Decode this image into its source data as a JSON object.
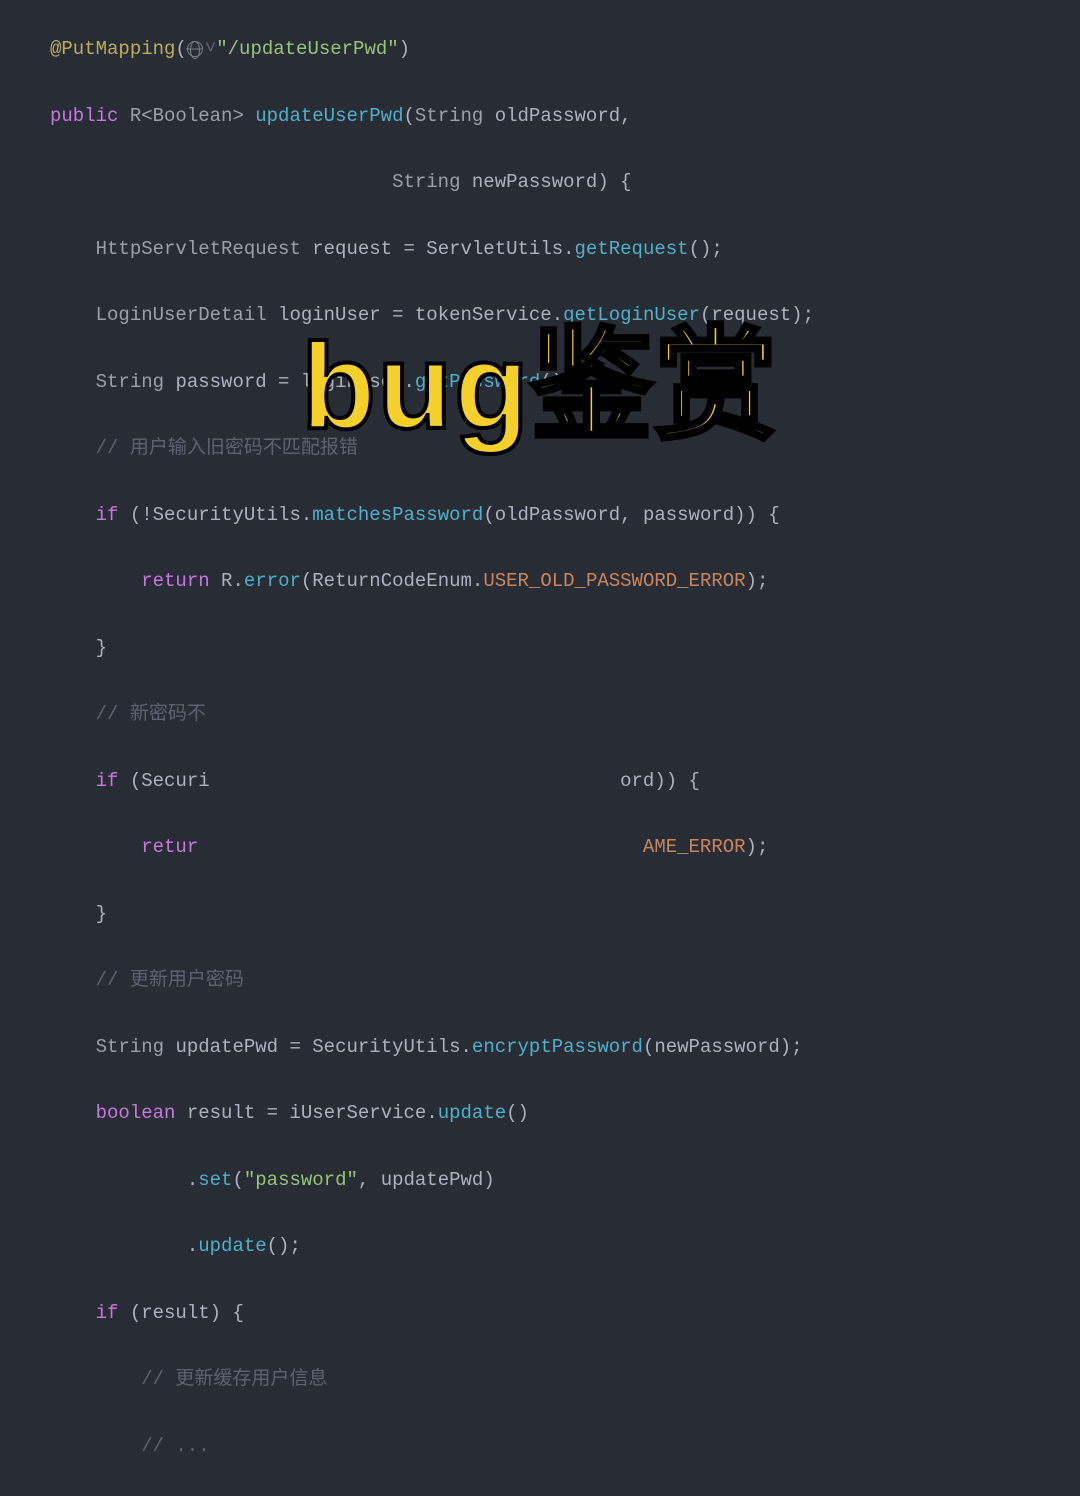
{
  "overlay": {
    "title": "bug鉴赏"
  },
  "code": {
    "l1": {
      "annotation": "@PutMapping",
      "paren_open": "(",
      "icon_suffix": "˅",
      "string": "\"/updateUserPwd\"",
      "paren_close": ")"
    },
    "l2": {
      "kw_public": "public",
      "type1": " R<Boolean> ",
      "method": "updateUserPwd",
      "paren_open": "(",
      "type2": "String ",
      "param1": "oldPassword",
      "comma": ","
    },
    "l3": {
      "indent": "                              ",
      "type": "String ",
      "param": "newPassword",
      "paren_close": ")",
      "brace": " {"
    },
    "l4": {
      "indent": "    ",
      "type1": "HttpServletRequest ",
      "var": "request",
      "eq": " = ",
      "cls": "ServletUtils",
      "dot": ".",
      "method": "getRequest",
      "call": "();"
    },
    "l5": {
      "indent": "    ",
      "type1": "LoginUserDetail ",
      "var": "loginUser",
      "eq": " = ",
      "obj": "tokenService",
      "dot": ".",
      "method": "getLoginUser",
      "args": "(request);"
    },
    "l6": {
      "indent": "    ",
      "type1": "String ",
      "var": "password",
      "eq": " = ",
      "obj": "loginUser",
      "dot": ".",
      "method": "getPassword",
      "call": "();"
    },
    "l7": {
      "indent": "    ",
      "comment": "// 用户输入旧密码不匹配报错"
    },
    "l8": {
      "indent": "    ",
      "kw_if": "if",
      "paren": " (!",
      "cls": "SecurityUtils",
      "dot": ".",
      "method": "matchesPassword",
      "args": "(oldPassword, password)) {"
    },
    "l9": {
      "indent": "        ",
      "kw_return": "return",
      "sp": " ",
      "cls": "R",
      "dot": ".",
      "method": "error",
      "paren_open": "(",
      "enum": "ReturnCodeEnum",
      "dot2": ".",
      "constant": "USER_OLD_PASSWORD_ERROR",
      "paren_close": ");"
    },
    "l10": {
      "indent": "    ",
      "brace": "}"
    },
    "l11": {
      "indent": "    ",
      "comment": "// 新密码不"
    },
    "l12": {
      "indent": "    ",
      "kw_if": "if",
      "paren": " (",
      "cls": "Securi",
      "tail": "ord)) {"
    },
    "l13": {
      "indent": "        ",
      "kw_return": "retur",
      "constant": "AME_ERROR",
      "paren_close": ");"
    },
    "l14": {
      "indent": "    ",
      "brace": "}"
    },
    "l15": {
      "indent": "    ",
      "comment": "// 更新用户密码"
    },
    "l16": {
      "indent": "    ",
      "type": "String ",
      "var": "updatePwd",
      "eq": " = ",
      "cls": "SecurityUtils",
      "dot": ".",
      "method": "encryptPassword",
      "args": "(newPassword);"
    },
    "l17": {
      "indent": "    ",
      "kw_boolean": "boolean",
      "sp": " ",
      "var": "result",
      "eq": " = ",
      "obj": "iUserService",
      "dot": ".",
      "method": "update",
      "call": "()"
    },
    "l18": {
      "indent": "            ",
      "dot": ".",
      "method": "set",
      "paren_open": "(",
      "string": "\"password\"",
      "comma": ", ",
      "arg": "updatePwd",
      "paren_close": ")"
    },
    "l19": {
      "indent": "            ",
      "dot": ".",
      "method": "update",
      "call": "();"
    },
    "l20": {
      "indent": "    ",
      "kw_if": "if",
      "paren": " (result) {"
    },
    "l21": {
      "indent": "        ",
      "comment": "// 更新缓存用户信息"
    },
    "l22": {
      "indent": "        ",
      "comment": "// ..."
    }
  }
}
